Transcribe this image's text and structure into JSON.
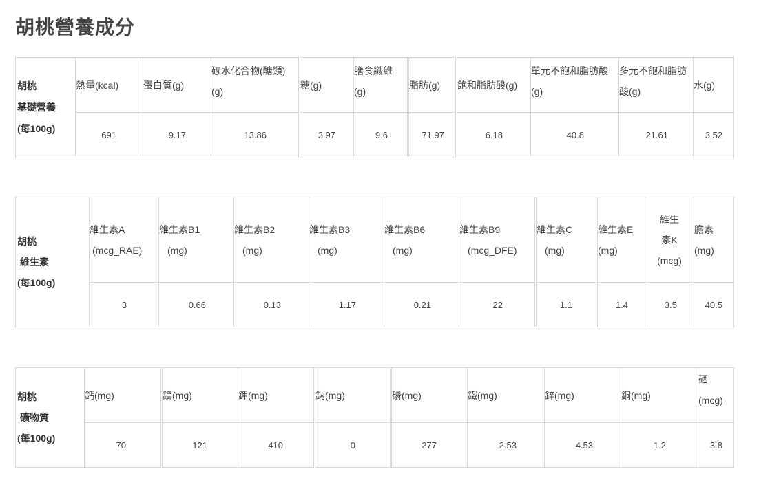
{
  "page": {
    "title": "胡桃營養成分"
  },
  "basic": {
    "row_header": [
      "胡桃",
      "基礎營養",
      "(每100g)"
    ],
    "headers": [
      [
        "熱量(kcal)"
      ],
      [
        "蛋白質(g)"
      ],
      [
        "碳水化合物(醣類)",
        "(g)"
      ],
      [
        "糖(g)"
      ],
      [
        "膳食纖維",
        "(g)"
      ],
      [
        "脂肪(g)"
      ],
      [
        "飽和脂肪酸(g)"
      ],
      [
        "單元不飽和脂肪酸",
        "(g)"
      ],
      [
        "多元不飽和脂肪",
        "酸(g)"
      ],
      [
        "水(g)"
      ]
    ],
    "values": [
      "691",
      "9.17",
      "13.86",
      "3.97",
      "9.6",
      "71.97",
      "6.18",
      "40.8",
      "21.61",
      "3.52"
    ]
  },
  "vitamins": {
    "row_header": [
      "胡桃",
      "維生素",
      "(每100g)"
    ],
    "headers": [
      [
        "維生素A",
        "(mcg_RAE)"
      ],
      [
        "維生素B1",
        "(mg)"
      ],
      [
        "維生素B2",
        "(mg)"
      ],
      [
        "維生素B3",
        "(mg)"
      ],
      [
        "維生素B6",
        "(mg)"
      ],
      [
        "維生素B9",
        "(mcg_DFE)"
      ],
      [
        "維生素C",
        "(mg)"
      ],
      [
        "維生素E",
        "(mg)"
      ],
      [
        "維生",
        "素K",
        "(mcg)"
      ],
      [
        "膽素",
        "(mg)"
      ]
    ],
    "values": [
      "3",
      "0.66",
      "0.13",
      "1.17",
      "0.21",
      "22",
      "1.1",
      "1.4",
      "3.5",
      "40.5"
    ]
  },
  "minerals": {
    "row_header": [
      "胡桃",
      "礦物質",
      "(每100g)"
    ],
    "headers": [
      [
        "鈣(mg)"
      ],
      [
        "鎂(mg)"
      ],
      [
        "鉀(mg)"
      ],
      [
        "鈉(mg)"
      ],
      [
        "磷(mg)"
      ],
      [
        "鐵(mg)"
      ],
      [
        "鋅(mg)"
      ],
      [
        "銅(mg)"
      ],
      [
        "硒",
        "(mcg)"
      ]
    ],
    "values": [
      "70",
      "121",
      "410",
      "0",
      "277",
      "2.53",
      "4.53",
      "1.2",
      "3.8"
    ]
  }
}
